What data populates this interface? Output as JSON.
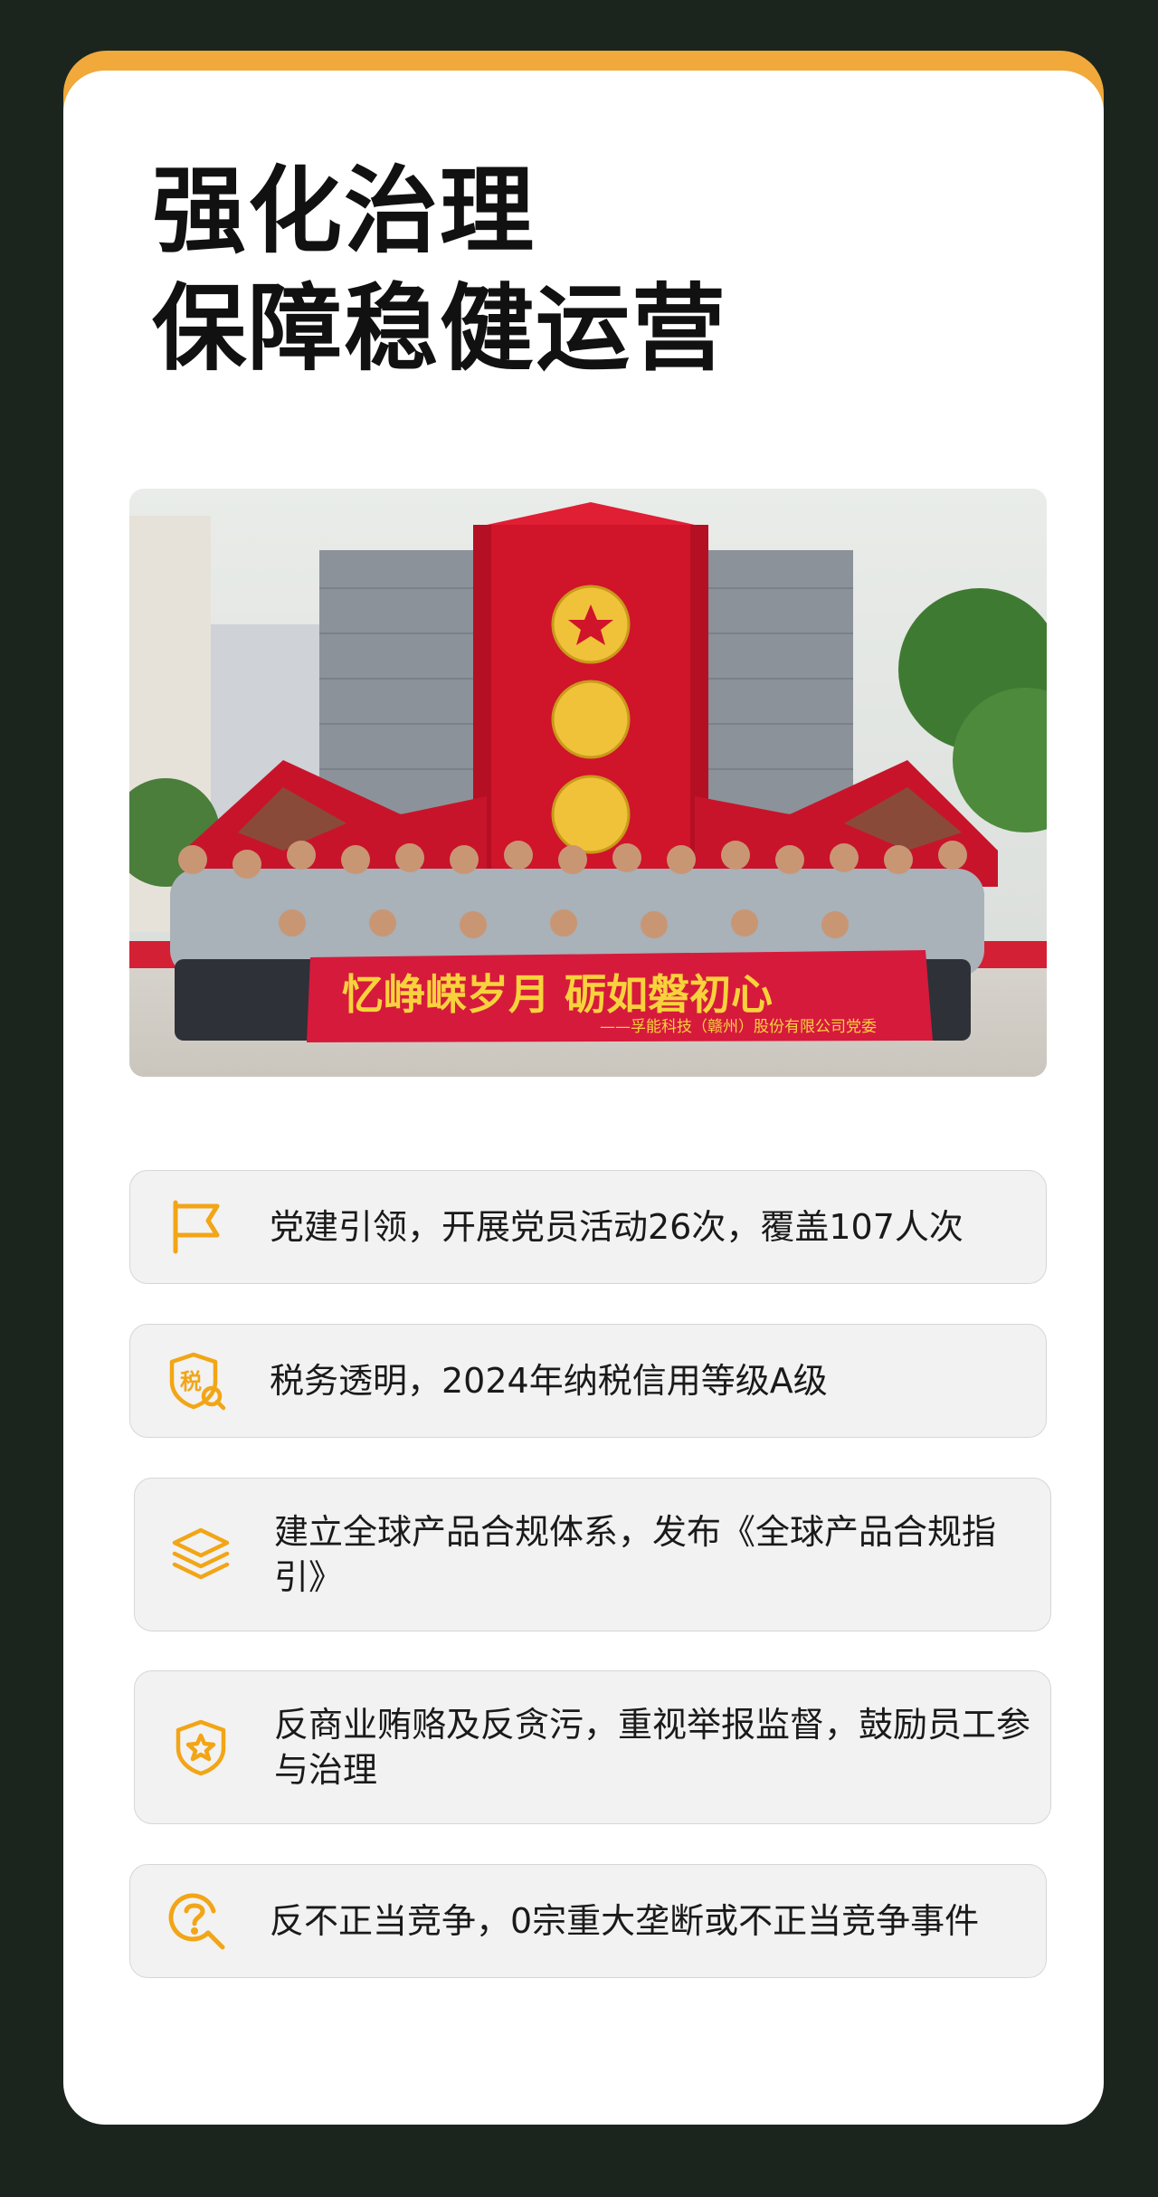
{
  "title": {
    "line1": "强化治理",
    "line2": "保障稳健运营"
  },
  "photo": {
    "banner_main": "忆峥嵘岁月  砺如磐初心",
    "banner_sub": "——孚能科技（赣州）股份有限公司党委"
  },
  "items": [
    {
      "icon": "flag-icon",
      "text": "党建引领，开展党员活动26次，覆盖107人次"
    },
    {
      "icon": "tax-shield-icon",
      "text": "税务透明，2024年纳税信用等级A级"
    },
    {
      "icon": "layers-icon",
      "text": "建立全球产品合规体系，发布《全球产品合规指引》"
    },
    {
      "icon": "star-shield-icon",
      "text": "反商业贿赂及反贪污，重视举报监督，鼓励员工参与治理"
    },
    {
      "icon": "question-search-icon",
      "text": "反不正当竞争，0宗重大垄断或不正当竞争事件"
    }
  ],
  "colors": {
    "background": "#1b251e",
    "accent": "#f0a93a",
    "icon": "#f2a516"
  }
}
